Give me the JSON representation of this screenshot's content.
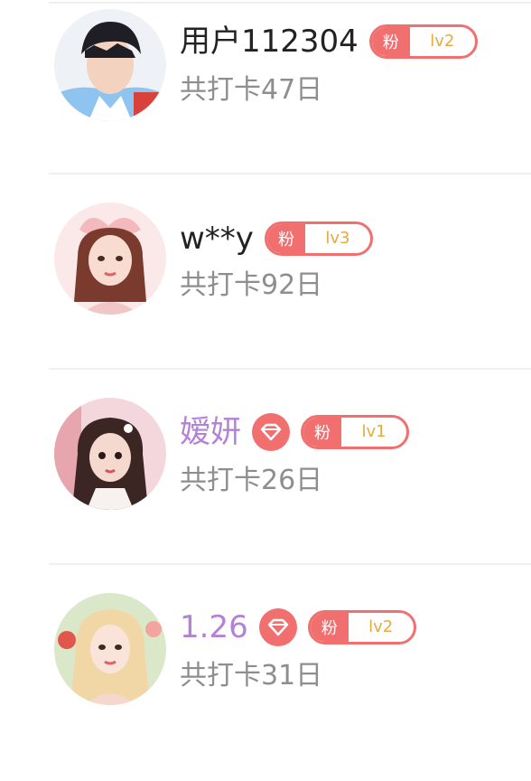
{
  "colors": {
    "accent": "#f26f6f",
    "vip_name": "#b382d6",
    "level_text": "#e8a93d",
    "subtext": "#8e8e8e"
  },
  "users": [
    {
      "name": "用户112304",
      "vip": false,
      "fan_label": "粉",
      "fan_level": "lv2",
      "checkin_text": "共打卡47日",
      "avatar_icon": "avatar-photo-boy-icon"
    },
    {
      "name": "w**y",
      "vip": false,
      "fan_label": "粉",
      "fan_level": "lv3",
      "checkin_text": "共打卡92日",
      "avatar_icon": "avatar-illustration-girl-bow-icon"
    },
    {
      "name": "嫒妍",
      "vip": true,
      "fan_label": "粉",
      "fan_level": "lv1",
      "checkin_text": "共打卡26日",
      "avatar_icon": "avatar-illustration-girl-dark-hair-icon"
    },
    {
      "name": "1.26",
      "vip": true,
      "fan_label": "粉",
      "fan_level": "lv2",
      "checkin_text": "共打卡31日",
      "avatar_icon": "avatar-photo-girl-blonde-icon"
    }
  ]
}
